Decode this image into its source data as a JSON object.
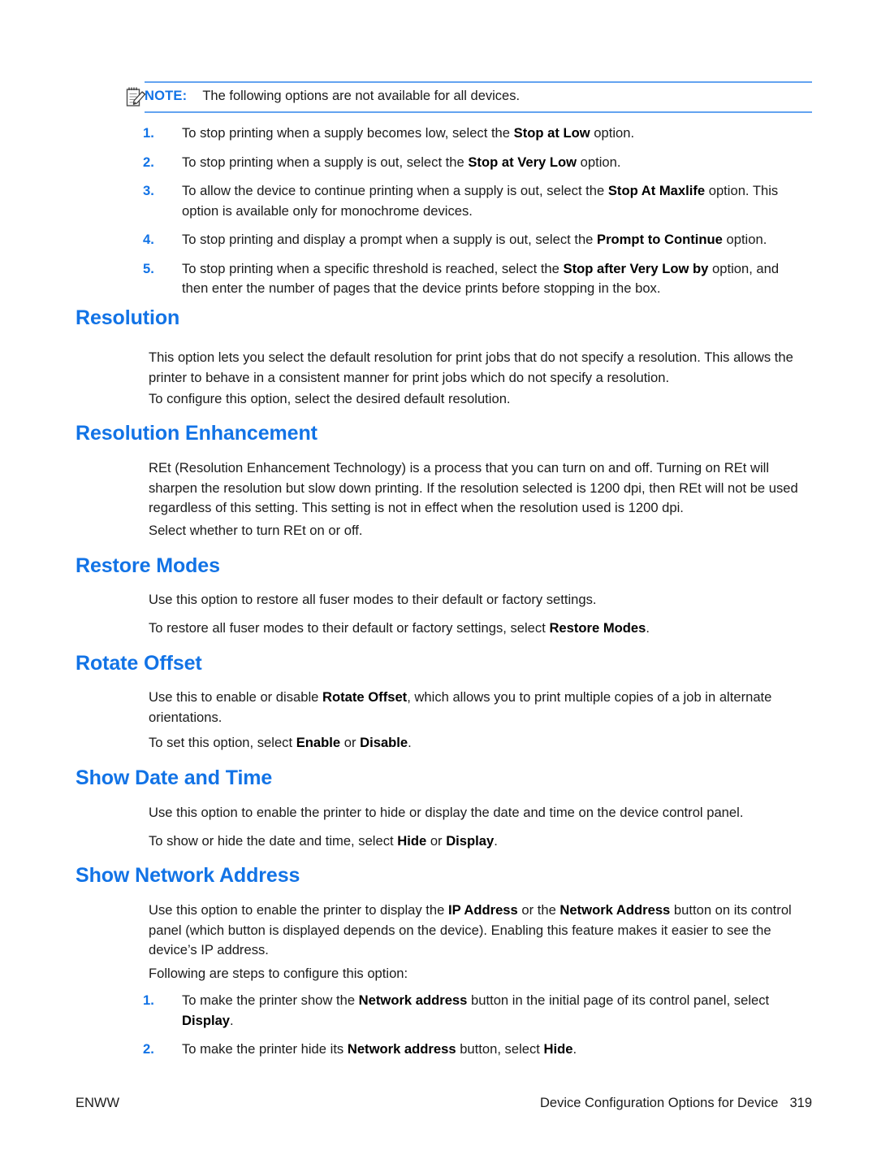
{
  "note": {
    "icon": "note-pencil-icon",
    "label": "NOTE:",
    "text": "The following options are not available for all devices.",
    "rule_color": "#63A3F0"
  },
  "colors": {
    "heading_blue": "#1273E6",
    "body_black": "#1b1b1b"
  },
  "intro_list": [
    {
      "num": "1.",
      "html": "To stop printing when a supply becomes low, select the <b>Stop at Low</b> option."
    },
    {
      "num": "2.",
      "html": "To stop printing when a supply is out, select the <b>Stop at Very Low</b> option."
    },
    {
      "num": "3.",
      "html": "To allow the device to continue printing when a supply is out, select the <b>Stop At Maxlife</b> option. This option is available only for monochrome devices."
    },
    {
      "num": "4.",
      "html": "To stop printing and display a prompt when a supply is out, select the <b>Prompt to Continue</b> option."
    },
    {
      "num": "5.",
      "html": "To stop printing when a specific threshold is reached, select the <b>Stop after Very Low by</b> option, and then enter the number of pages that the device prints before stopping in the box."
    }
  ],
  "sections": {
    "resolution": {
      "heading": "Resolution",
      "p1": "This option lets you select the default resolution for print jobs that do not specify a resolution. This allows the printer to behave in a consistent manner for print jobs which do not specify a resolution.",
      "p2": "To configure this option, select the desired default resolution."
    },
    "resolution_enhancement": {
      "heading": "Resolution Enhancement",
      "p1": "REt (Resolution Enhancement Technology) is a process that you can turn on and off. Turning on REt will sharpen the resolution but slow down printing. If the resolution selected is 1200 dpi, then REt will not be used regardless of this setting. This setting is not in effect when the resolution used is 1200 dpi.",
      "p2": "Select whether to turn REt on or off."
    },
    "restore_modes": {
      "heading": "Restore Modes",
      "p1": "Use this option to restore all fuser modes to their default or factory settings.",
      "p2_html": "To restore all fuser modes to their default or factory settings, select <b>Restore Modes</b>."
    },
    "rotate_offset": {
      "heading": "Rotate Offset",
      "p1_html": "Use this to enable or disable <b>Rotate Offset</b>, which allows you to print multiple copies of a job in alternate orientations.",
      "p2_html": "To set this option, select <b>Enable</b> or <b>Disable</b>."
    },
    "show_date_and_time": {
      "heading": "Show Date and Time",
      "p1": "Use this option to enable the printer to hide or display the date and time on the device control panel.",
      "p2_html": "To show or hide the date and time, select <b>Hide</b> or <b>Display</b>."
    },
    "show_network_address": {
      "heading": "Show Network Address",
      "p1_html": "Use this option to enable the printer to display the <b>IP Address</b> or the <b>Network Address</b> button on its control panel (which button is displayed depends on the device). Enabling this feature makes it easier to see the device’s IP address.",
      "p2": "Following are steps to configure this option:",
      "list": [
        {
          "num": "1.",
          "html": "To make the printer show the <b>Network address</b> button in the initial page of its control panel, select <b>Display</b>."
        },
        {
          "num": "2.",
          "html": "To make the printer hide its <b>Network address</b> button, select <b>Hide</b>."
        }
      ]
    }
  },
  "footer": {
    "left": "ENWW",
    "right": "Device Configuration Options for Device",
    "page_number": "319"
  }
}
